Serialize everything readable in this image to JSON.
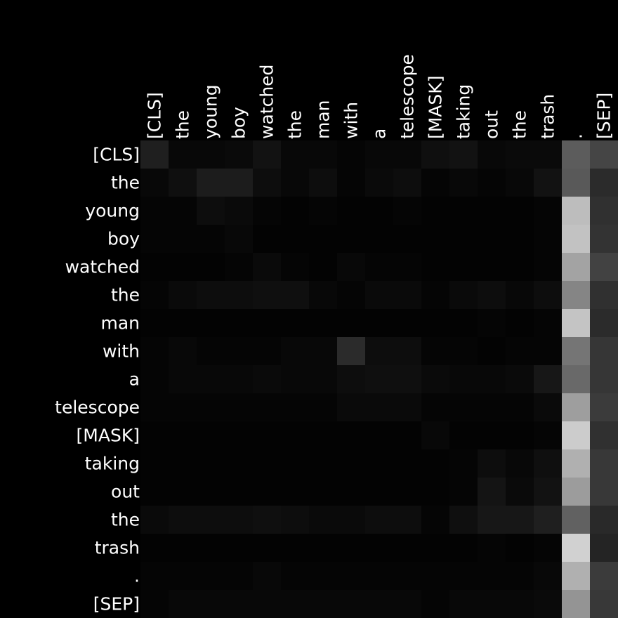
{
  "chart_data": {
    "type": "heatmap",
    "colormap": "grayscale",
    "grid": false,
    "vmin": 0,
    "vmax": 1,
    "x_tick_labels": [
      "[CLS]",
      "the",
      "young",
      "boy",
      "watched",
      "the",
      "man",
      "with",
      "a",
      "telescope",
      "[MASK]",
      "taking",
      "out",
      "the",
      "trash",
      ".",
      "[SEP]"
    ],
    "y_tick_labels": [
      "[CLS]",
      "the",
      "young",
      "boy",
      "watched",
      "the",
      "man",
      "with",
      "a",
      "telescope",
      "[MASK]",
      "taking",
      "out",
      "the",
      "trash",
      ".",
      "[SEP]"
    ],
    "values": [
      [
        0.12,
        0.03,
        0.03,
        0.04,
        0.07,
        0.03,
        0.03,
        0.02,
        0.03,
        0.03,
        0.06,
        0.07,
        0.03,
        0.04,
        0.04,
        0.36,
        0.27
      ],
      [
        0.03,
        0.06,
        0.11,
        0.11,
        0.05,
        0.03,
        0.05,
        0.02,
        0.04,
        0.05,
        0.02,
        0.03,
        0.02,
        0.03,
        0.07,
        0.35,
        0.17
      ],
      [
        0.02,
        0.02,
        0.05,
        0.04,
        0.02,
        0.01,
        0.02,
        0.01,
        0.01,
        0.02,
        0.01,
        0.01,
        0.01,
        0.01,
        0.02,
        0.74,
        0.19
      ],
      [
        0.02,
        0.02,
        0.02,
        0.03,
        0.01,
        0.01,
        0.01,
        0.01,
        0.01,
        0.01,
        0.01,
        0.01,
        0.01,
        0.01,
        0.02,
        0.76,
        0.2
      ],
      [
        0.01,
        0.01,
        0.01,
        0.02,
        0.04,
        0.02,
        0.01,
        0.03,
        0.02,
        0.02,
        0.01,
        0.01,
        0.01,
        0.01,
        0.02,
        0.64,
        0.26
      ],
      [
        0.02,
        0.04,
        0.05,
        0.05,
        0.06,
        0.06,
        0.03,
        0.02,
        0.04,
        0.04,
        0.02,
        0.04,
        0.05,
        0.03,
        0.05,
        0.52,
        0.19
      ],
      [
        0.01,
        0.01,
        0.01,
        0.01,
        0.01,
        0.01,
        0.01,
        0.01,
        0.01,
        0.01,
        0.01,
        0.01,
        0.02,
        0.01,
        0.02,
        0.77,
        0.17
      ],
      [
        0.02,
        0.03,
        0.02,
        0.02,
        0.02,
        0.03,
        0.03,
        0.17,
        0.05,
        0.05,
        0.02,
        0.02,
        0.01,
        0.02,
        0.02,
        0.46,
        0.21
      ],
      [
        0.02,
        0.03,
        0.03,
        0.03,
        0.04,
        0.03,
        0.03,
        0.05,
        0.06,
        0.06,
        0.04,
        0.03,
        0.03,
        0.04,
        0.09,
        0.41,
        0.21
      ],
      [
        0.02,
        0.02,
        0.02,
        0.02,
        0.02,
        0.02,
        0.02,
        0.04,
        0.04,
        0.04,
        0.02,
        0.02,
        0.02,
        0.02,
        0.04,
        0.62,
        0.23
      ],
      [
        0.01,
        0.01,
        0.01,
        0.01,
        0.01,
        0.01,
        0.01,
        0.01,
        0.01,
        0.01,
        0.03,
        0.01,
        0.01,
        0.01,
        0.02,
        0.8,
        0.19
      ],
      [
        0.01,
        0.01,
        0.01,
        0.01,
        0.01,
        0.01,
        0.01,
        0.01,
        0.01,
        0.01,
        0.01,
        0.02,
        0.05,
        0.03,
        0.06,
        0.69,
        0.22
      ],
      [
        0.01,
        0.01,
        0.01,
        0.01,
        0.01,
        0.01,
        0.01,
        0.01,
        0.01,
        0.01,
        0.01,
        0.02,
        0.08,
        0.04,
        0.07,
        0.61,
        0.22
      ],
      [
        0.04,
        0.05,
        0.05,
        0.05,
        0.06,
        0.05,
        0.04,
        0.04,
        0.05,
        0.05,
        0.02,
        0.06,
        0.09,
        0.09,
        0.12,
        0.38,
        0.16
      ],
      [
        0.01,
        0.01,
        0.01,
        0.01,
        0.01,
        0.01,
        0.01,
        0.01,
        0.01,
        0.01,
        0.01,
        0.01,
        0.02,
        0.01,
        0.02,
        0.82,
        0.14
      ],
      [
        0.02,
        0.02,
        0.02,
        0.02,
        0.03,
        0.02,
        0.02,
        0.02,
        0.02,
        0.02,
        0.02,
        0.02,
        0.02,
        0.02,
        0.03,
        0.69,
        0.23
      ],
      [
        0.02,
        0.03,
        0.03,
        0.03,
        0.03,
        0.03,
        0.03,
        0.03,
        0.03,
        0.03,
        0.02,
        0.03,
        0.03,
        0.03,
        0.04,
        0.58,
        0.22
      ]
    ]
  }
}
